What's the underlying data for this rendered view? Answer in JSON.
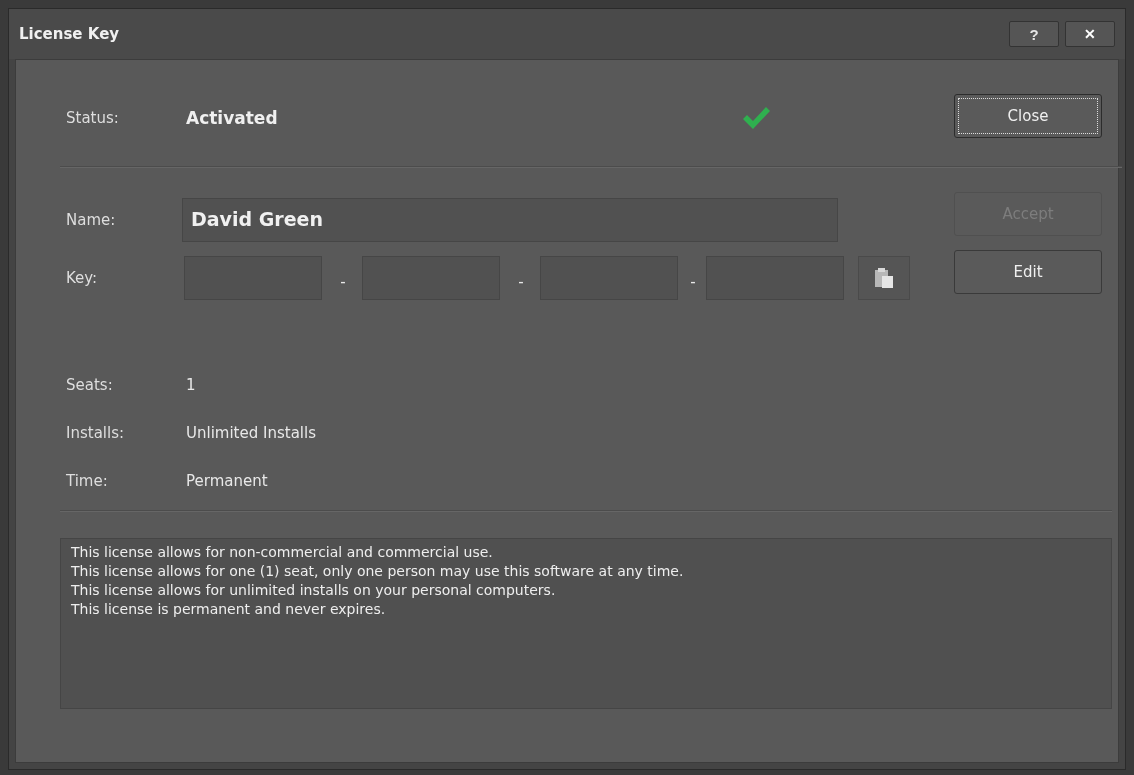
{
  "window": {
    "title": "License Key",
    "title_buttons": [
      {
        "kind": "help",
        "label": "?"
      },
      {
        "kind": "close",
        "label": "✕"
      }
    ]
  },
  "status": {
    "label": "Status:",
    "value": "Activated",
    "ok": true
  },
  "buttons": [
    {
      "label": "Close",
      "focused": true,
      "disabled": false
    },
    {
      "label": "Accept",
      "focused": false,
      "disabled": true
    },
    {
      "label": "Edit",
      "focused": false,
      "disabled": false
    }
  ],
  "name": {
    "label": "Name:",
    "value": "David Green"
  },
  "key": {
    "label": "Key:",
    "separator": "-",
    "segments": [
      {
        "filled": false
      },
      {
        "filled": false
      },
      {
        "filled": false
      },
      {
        "filled": false
      }
    ]
  },
  "details": [
    {
      "label": "Seats:",
      "value": "1"
    },
    {
      "label": "Installs:",
      "value": "Unlimited Installs"
    },
    {
      "label": "Time:",
      "value": "Permanent"
    }
  ],
  "terms": [
    "This license allows for non-commercial and commercial use.",
    "This license allows for one (1) seat, only one person may use this software at any time.",
    "This license allows for unlimited installs on your personal computers.",
    "This license is permanent and never expires."
  ]
}
